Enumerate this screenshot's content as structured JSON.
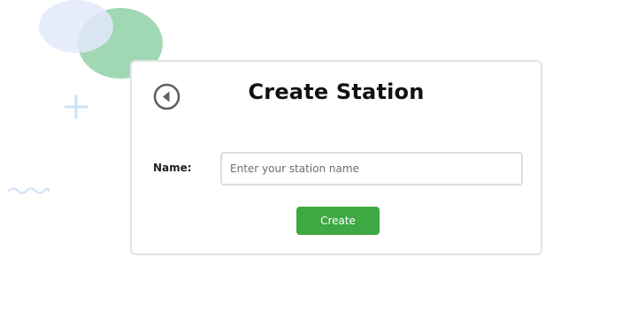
{
  "page": {
    "title": "Create Station"
  },
  "form": {
    "name_label": "Name:",
    "name_placeholder": "Enter your station name",
    "name_value": ""
  },
  "actions": {
    "create_label": "Create",
    "back_icon": "back-arrow-icon"
  },
  "colors": {
    "accent": "#3ea843",
    "blob_green": "#8fd1a6",
    "blob_blue": "#e6ecfa"
  }
}
